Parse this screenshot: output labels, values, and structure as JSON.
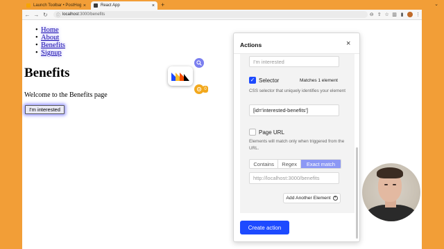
{
  "browser": {
    "tabs": [
      {
        "label": "Launch Toolbar • PostHog",
        "favicon_color": "#f7a501",
        "active": false
      },
      {
        "label": "React App",
        "favicon_color": "#3b3b3b",
        "active": true
      }
    ],
    "new_tab_label": "+",
    "url_host": "localhost",
    "url_rest": ":3000/benefits",
    "nav_icons": [
      "back-arrow-icon",
      "forward-arrow-icon",
      "reload-icon"
    ]
  },
  "page": {
    "nav_links": [
      "Home",
      "About",
      "Benefits",
      "Signup"
    ],
    "heading": "Benefits",
    "welcome": "Welcome to the Benefits page",
    "button_label": "I'm interested"
  },
  "toolbar": {
    "badge_count": "0"
  },
  "actions_panel": {
    "title": "Actions",
    "name_value": "I'm interested",
    "selector_label": "Selector",
    "selector_checked": true,
    "matches_text": "Matches 1 element",
    "selector_help": "CSS selector that uniquely identifies your element",
    "selector_value": "[id='interested-benefits']",
    "url_label": "Page URL",
    "url_checked": false,
    "url_help": "Elements will match only when triggered from the URL.",
    "match_modes": [
      "Contains",
      "Regex",
      "Exact match"
    ],
    "match_mode_selected": "Exact match",
    "url_placeholder": "http://localhost:3000/benefits",
    "add_element_label": "Add Another Element",
    "create_label": "Create action"
  },
  "colors": {
    "browser_frame": "#f29e37",
    "primary": "#1d4aff",
    "toolbar_search": "#7b7ff0",
    "toolbar_action": "#f2a81d"
  }
}
